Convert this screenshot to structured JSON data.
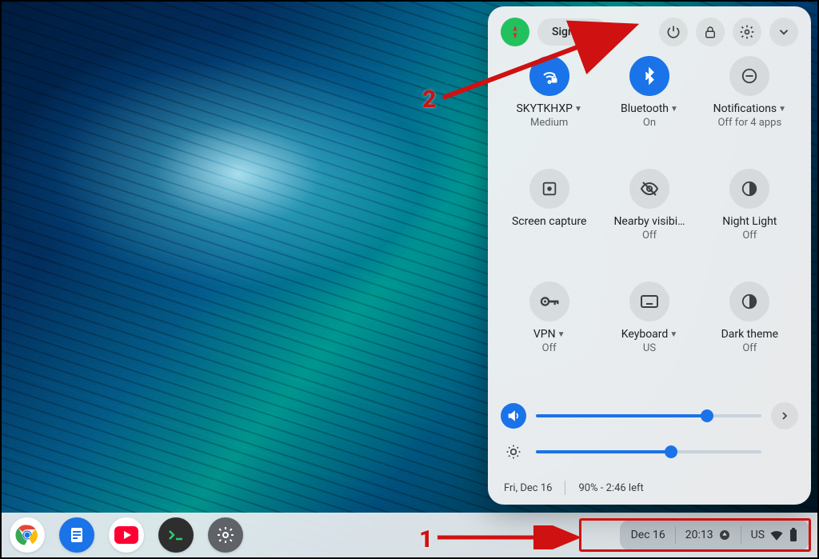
{
  "panel": {
    "sign_out": "Sign out",
    "tiles": [
      {
        "label": "SKYTKHXP",
        "sublabel": "Medium",
        "has_caret": true,
        "on": true,
        "icon": "wifi-lock"
      },
      {
        "label": "Bluetooth",
        "sublabel": "On",
        "has_caret": true,
        "on": true,
        "icon": "bluetooth"
      },
      {
        "label": "Notifications",
        "sublabel": "Off for 4 apps",
        "has_caret": true,
        "on": false,
        "icon": "dnd"
      },
      {
        "label": "Screen capture",
        "sublabel": "",
        "has_caret": false,
        "on": false,
        "icon": "screen-capture"
      },
      {
        "label": "Nearby visibi…",
        "sublabel": "Off",
        "has_caret": false,
        "on": false,
        "icon": "visibility-off"
      },
      {
        "label": "Night Light",
        "sublabel": "Off",
        "has_caret": false,
        "on": false,
        "icon": "night-light"
      },
      {
        "label": "VPN",
        "sublabel": "Off",
        "has_caret": true,
        "on": false,
        "icon": "vpn-key"
      },
      {
        "label": "Keyboard",
        "sublabel": "US",
        "has_caret": true,
        "on": false,
        "icon": "keyboard"
      },
      {
        "label": "Dark theme",
        "sublabel": "Off",
        "has_caret": false,
        "on": false,
        "icon": "dark-theme"
      }
    ],
    "volume_pct": 76,
    "brightness_pct": 60,
    "footer_date": "Fri, Dec 16",
    "footer_battery": "90% - 2:46 left"
  },
  "shelf": {
    "date": "Dec 16",
    "time": "20:13",
    "ime": "US"
  },
  "annotations": {
    "n1": "1",
    "n2": "2"
  }
}
